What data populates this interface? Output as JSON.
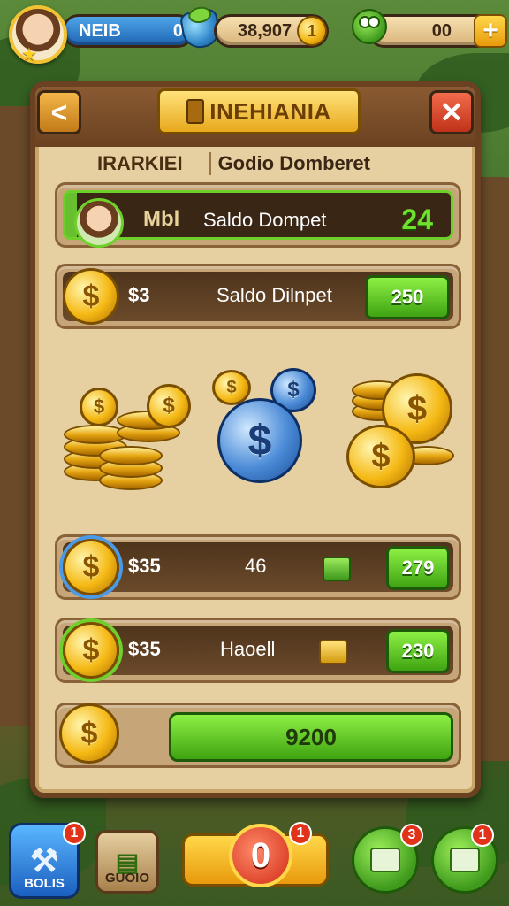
{
  "hud": {
    "player_name": "NEIB",
    "player_level": "0",
    "gold_amount": "38,907",
    "gold_coin_symbol": "1",
    "green_amount": "00",
    "plus_label": "+"
  },
  "panel": {
    "back_label": "<",
    "close_label": "✕",
    "title": "INEHIANIA",
    "tabs": [
      "IRARKIEI",
      "Godio Domberet"
    ],
    "row1": {
      "label_a": "Mbl",
      "label_b": "Saldo Dompet",
      "value": "24"
    },
    "row2": {
      "coin_symbol": "$",
      "amount": "$3",
      "label": "Saldo Dilnpet",
      "button": "250"
    },
    "row3": {
      "coin_symbol": "$",
      "amount": "$35",
      "label": "46",
      "button": "279"
    },
    "row4": {
      "coin_symbol": "$",
      "amount": "$35",
      "label": "Haoell",
      "button": "230"
    },
    "row5": {
      "coin_symbol": "$",
      "button": "9200"
    },
    "coin_symbol": "$"
  },
  "bottom_nav": {
    "bolts_label": "BOLIS",
    "bolts_badge": "1",
    "guide_label": "GUOIO",
    "center_value": "0",
    "center_badge": "1",
    "round1_badge": "3",
    "round2_badge": "1"
  },
  "colors": {
    "accent_green": "#3fa312",
    "accent_gold": "#f5b915",
    "panel_bg": "#e6cfa0",
    "wood": "#6b4221"
  }
}
